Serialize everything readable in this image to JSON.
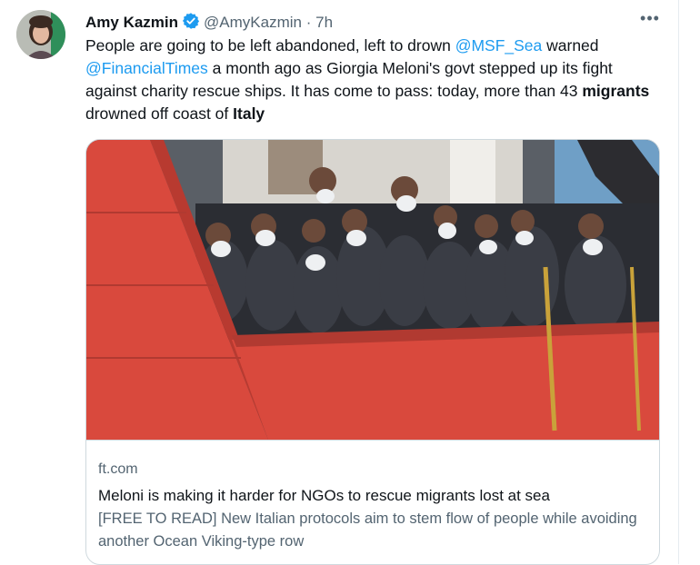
{
  "tweet": {
    "author_name": "Amy Kazmin",
    "handle": "@AmyKazmin",
    "separator": "·",
    "time": "7h",
    "more_label": "•••",
    "text_parts": {
      "p1": "People are going to be left abandoned, left to drown ",
      "m1": "@MSF_Sea",
      "p2": " warned ",
      "m2": "@FinancialTimes",
      "p3": " a month ago as Giorgia Meloni's govt stepped up its fight against charity rescue ships. It has come to pass: today, more than 43 ",
      "b1": "migrants",
      "p4": " drowned off coast of ",
      "b2": "Italy"
    }
  },
  "card": {
    "domain": "ft.com",
    "title": "Meloni is making it harder for NGOs to rescue migrants lost at sea",
    "description": "[FREE TO READ] New Italian protocols aim to stem flow of people while avoiding another Ocean Viking-type row"
  },
  "icons": {
    "verified": "verified-badge-icon",
    "more": "more-options-icon"
  },
  "colors": {
    "link": "#1d9bf0",
    "verified": "#1d9bf0",
    "secondary_text": "#536471",
    "ship_hull": "#d9493d"
  }
}
